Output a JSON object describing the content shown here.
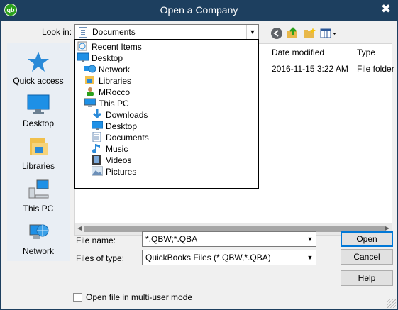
{
  "window": {
    "title": "Open a Company",
    "app_icon_text": "qb",
    "close_glyph": "✖"
  },
  "look_in": {
    "label": "Look in:",
    "value": "Documents"
  },
  "sidebar": {
    "items": [
      {
        "label": "Quick access",
        "icon": "quick-access-star-icon"
      },
      {
        "label": "Desktop",
        "icon": "desktop-monitor-icon"
      },
      {
        "label": "Libraries",
        "icon": "libraries-folder-icon"
      },
      {
        "label": "This PC",
        "icon": "computer-icon"
      },
      {
        "label": "Network",
        "icon": "network-globe-icon"
      }
    ]
  },
  "list": {
    "columns": [
      {
        "label": "Date modified"
      },
      {
        "label": "Type"
      }
    ],
    "rows": [
      {
        "date": "2016-11-15 3:22 AM",
        "type": "File folder"
      }
    ]
  },
  "dropdown": {
    "items": [
      {
        "label": "Recent Items",
        "icon": "recent-items-icon",
        "level": 0
      },
      {
        "label": "Desktop",
        "icon": "desktop-icon",
        "level": 0
      },
      {
        "label": "Network",
        "icon": "network-icon",
        "level": 1
      },
      {
        "label": "Libraries",
        "icon": "libraries-icon",
        "level": 1
      },
      {
        "label": "MRocco",
        "icon": "user-icon",
        "level": 1
      },
      {
        "label": "This PC",
        "icon": "computer-icon",
        "level": 1
      },
      {
        "label": "Downloads",
        "icon": "downloads-arrow-icon",
        "level": 2
      },
      {
        "label": "Desktop",
        "icon": "desktop-icon",
        "level": 2
      },
      {
        "label": "Documents",
        "icon": "documents-icon",
        "level": 2
      },
      {
        "label": "Music",
        "icon": "music-note-icon",
        "level": 2
      },
      {
        "label": "Videos",
        "icon": "videos-icon",
        "level": 2
      },
      {
        "label": "Pictures",
        "icon": "pictures-icon",
        "level": 2
      }
    ]
  },
  "file_name": {
    "label": "File name:",
    "value": "*.QBW;*.QBA"
  },
  "files_of_type": {
    "label": "Files of type:",
    "value": "QuickBooks Files (*.QBW,*.QBA)"
  },
  "buttons": {
    "open": "Open",
    "cancel": "Cancel",
    "help": "Help"
  },
  "multi_user": {
    "label": "Open file in multi-user mode",
    "checked": false
  },
  "colors": {
    "titlebar": "#1d3f5f",
    "accent": "#0078d7",
    "sidebar_bg": "#e9eef4"
  }
}
